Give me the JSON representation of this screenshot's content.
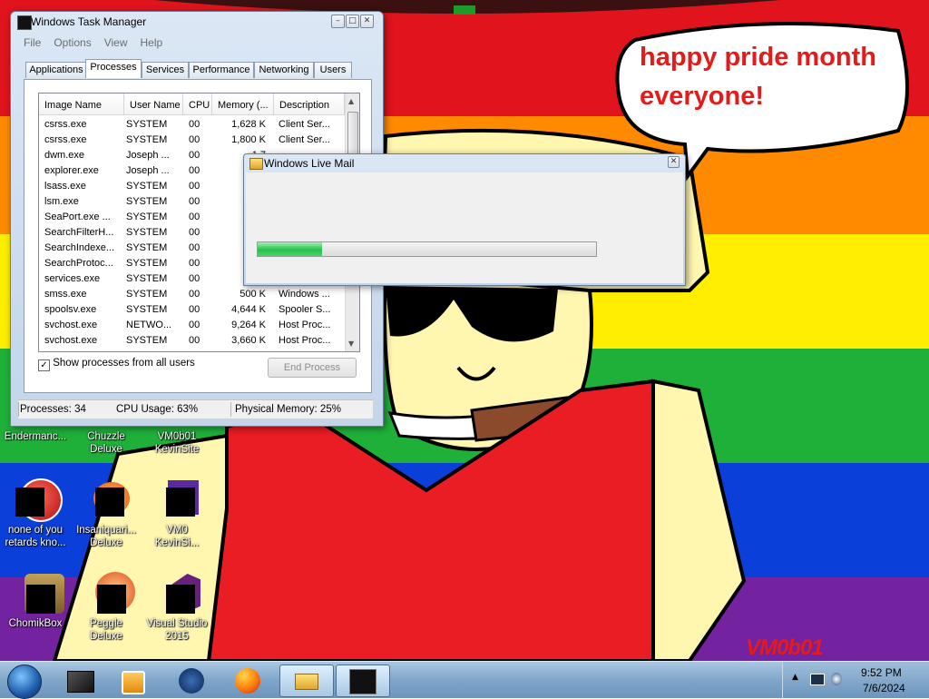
{
  "wallpaper": {
    "stripes": [
      "#e1131c",
      "#ff8a00",
      "#ffee00",
      "#1fb03a",
      "#0b3fd9",
      "#7323a0"
    ],
    "speech_bubble": "happy pride month everyone!",
    "speech_line1": "happy pride month",
    "speech_line2": "everyone!",
    "signature": "VM0b01"
  },
  "desktop_icons": [
    {
      "label": "Endermanc..."
    },
    {
      "label": "Chuzzle Deluxe"
    },
    {
      "label": "VM0b01 KevinSite"
    },
    {
      "label": "none of you retards kno..."
    },
    {
      "label": "Insaniquari... Deluxe"
    },
    {
      "label": "VM0 KevinSi..."
    },
    {
      "label": "ChomikBox"
    },
    {
      "label": "Peggle Deluxe"
    },
    {
      "label": "Visual Studio 2015"
    }
  ],
  "task_manager": {
    "title": "Windows Task Manager",
    "menu": [
      "File",
      "Options",
      "View",
      "Help"
    ],
    "tabs": [
      "Applications",
      "Processes",
      "Services",
      "Performance",
      "Networking",
      "Users"
    ],
    "active_tab": "Processes",
    "columns": [
      "Image Name",
      "User Name",
      "CPU",
      "Memory (...",
      "Description"
    ],
    "rows": [
      [
        "csrss.exe",
        "SYSTEM",
        "00",
        "1,628 K",
        "Client Ser..."
      ],
      [
        "csrss.exe",
        "SYSTEM",
        "00",
        "1,800 K",
        "Client Ser..."
      ],
      [
        "dwm.exe",
        "Joseph ...",
        "00",
        "1,7",
        ""
      ],
      [
        "explorer.exe",
        "Joseph ...",
        "00",
        "12,",
        ""
      ],
      [
        "lsass.exe",
        "SYSTEM",
        "00",
        "3,",
        ""
      ],
      [
        "lsm.exe",
        "SYSTEM",
        "00",
        "1,6",
        ""
      ],
      [
        "SeaPort.exe ...",
        "SYSTEM",
        "00",
        "5,",
        ""
      ],
      [
        "SearchFilterH...",
        "SYSTEM",
        "00",
        "2,",
        ""
      ],
      [
        "SearchIndexe...",
        "SYSTEM",
        "00",
        "9,",
        ""
      ],
      [
        "SearchProtoc...",
        "SYSTEM",
        "00",
        "2,",
        ""
      ],
      [
        "services.exe",
        "SYSTEM",
        "00",
        "3,",
        ""
      ],
      [
        "smss.exe",
        "SYSTEM",
        "00",
        "500 K",
        "Windows ..."
      ],
      [
        "spoolsv.exe",
        "SYSTEM",
        "00",
        "4,644 K",
        "Spooler S..."
      ],
      [
        "svchost.exe",
        "NETWO...",
        "00",
        "9,264 K",
        "Host Proc..."
      ],
      [
        "svchost.exe",
        "SYSTEM",
        "00",
        "3,660 K",
        "Host Proc..."
      ]
    ],
    "show_all_label": "Show processes from all users",
    "show_all_checked": true,
    "end_process_label": "End Process",
    "status": {
      "processes": "Processes: 34",
      "cpu": "CPU Usage: 63%",
      "memory": "Physical Memory: 25%"
    }
  },
  "live_mail": {
    "title": "Windows Live Mail",
    "progress": 0.19
  },
  "taskbar": {
    "time": "9:52 PM",
    "date": "7/6/2024",
    "buttons": [
      "start-orb",
      "task-manager",
      "media-player",
      "windows-logo-app",
      "firefox",
      "windows-live-mail",
      "terminal-app"
    ]
  }
}
